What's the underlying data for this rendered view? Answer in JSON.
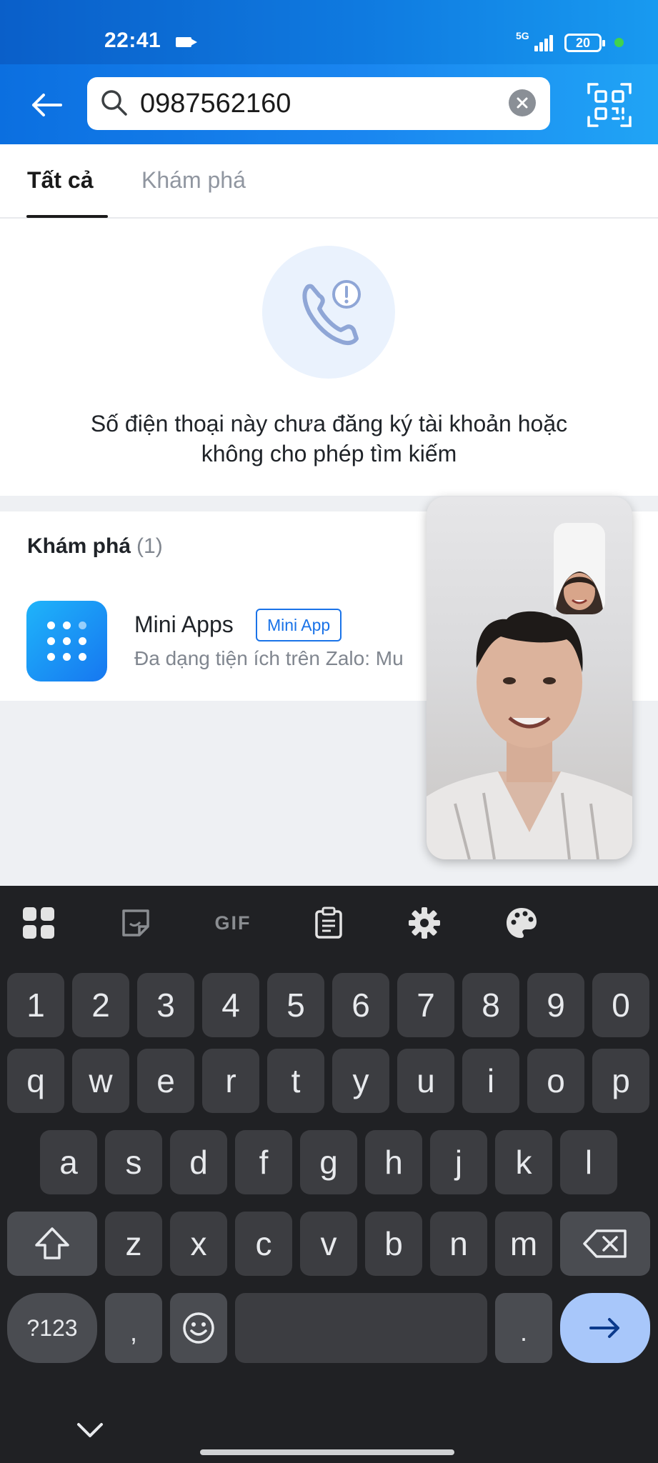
{
  "status_bar": {
    "time": "22:41",
    "network": "5G",
    "battery": "20"
  },
  "search": {
    "value": "0987562160",
    "placeholder": ""
  },
  "tabs": [
    {
      "label": "Tất cả",
      "active": true
    },
    {
      "label": "Khám phá",
      "active": false
    }
  ],
  "empty_state": {
    "message_line1": "Số điện thoại này chưa đăng ký tài khoản hoặc",
    "message_line2": "không cho phép tìm kiếm"
  },
  "explore": {
    "title": "Khám phá",
    "count": "(1)",
    "items": [
      {
        "name": "Mini Apps",
        "badge": "Mini App",
        "description": "Đa dạng tiện ích trên Zalo: Mu"
      }
    ]
  },
  "keyboard": {
    "toolbar": [
      "apps-grid-icon",
      "sticker-icon",
      "GIF",
      "clipboard-icon",
      "settings-icon",
      "palette-icon"
    ],
    "row_numbers": [
      "1",
      "2",
      "3",
      "4",
      "5",
      "6",
      "7",
      "8",
      "9",
      "0"
    ],
    "row_1": [
      "q",
      "w",
      "e",
      "r",
      "t",
      "y",
      "u",
      "i",
      "o",
      "p"
    ],
    "row_2": [
      "a",
      "s",
      "d",
      "f",
      "g",
      "h",
      "j",
      "k",
      "l"
    ],
    "row_3": [
      "z",
      "x",
      "c",
      "v",
      "b",
      "n",
      "m"
    ],
    "symbols_label": "?123",
    "comma": ",",
    "period": "."
  },
  "colors": {
    "header_blue": "#1a86f0",
    "accent": "#1a73e8",
    "keyboard_bg": "#202124",
    "enter_key": "#a8c7fa"
  }
}
